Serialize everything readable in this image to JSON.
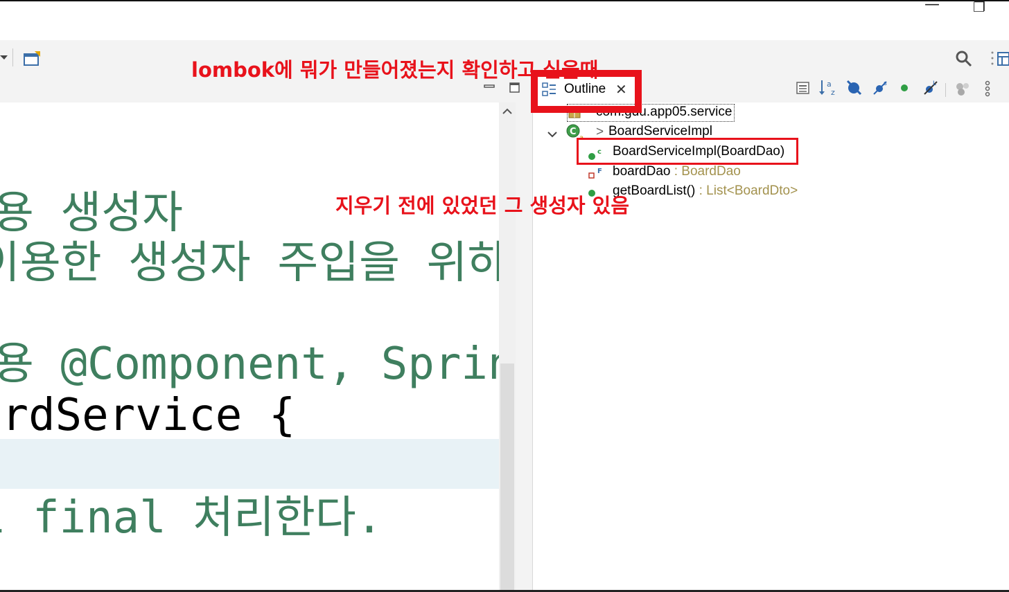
{
  "window": {
    "minimize_glyph": "—",
    "restore_glyph": "❐"
  },
  "toolbar": {
    "dropdown_icon": "chevron-down-icon",
    "new_icon": "new-window-icon",
    "search_icon": "search-icon",
    "perspective_icon": "perspective-icon"
  },
  "editor": {
    "lines": [
      {
        "text": "용 생성자",
        "kind": "comment"
      },
      {
        "text": "이용한 생성자 주입을 위하",
        "kind": "comment"
      },
      {
        "text": "용 @Component, Spring Co",
        "kind": "comment"
      },
      {
        "text": "ardService {",
        "kind": "plain"
      },
      {
        "text": "l final 처리한다.",
        "kind": "comment"
      }
    ]
  },
  "outline": {
    "tab_label": "Outline",
    "tab_close": "✕",
    "package": "com.gdu.app05.service",
    "class_name": "BoardServiceImpl",
    "class_prefix": ">",
    "members": [
      {
        "name": "BoardServiceImpl(BoardDao)",
        "type": "",
        "marker": "c"
      },
      {
        "name": "boardDao",
        "type": ": BoardDao",
        "marker": "F"
      },
      {
        "name": "getBoardList()",
        "type": ": List<BoardDto>",
        "marker": ""
      }
    ]
  },
  "annotations": {
    "top": "lombok에 뭐가 만들어졌는지 확인하고 싶을때",
    "middle": "지우기 전에 있었던 그 생성자 있음"
  },
  "colors": {
    "annotation_red": "#e8121b",
    "comment_green": "#3f7f5f"
  }
}
